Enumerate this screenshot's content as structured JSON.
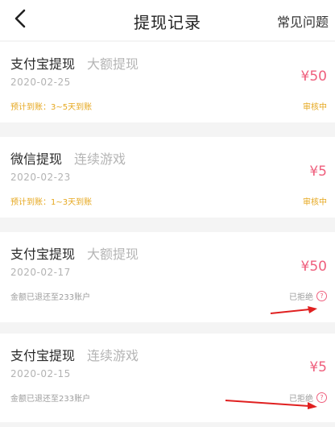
{
  "header": {
    "back_icon": "chevron-left-icon",
    "title": "提现记录",
    "faq_label": "常见问题"
  },
  "records": [
    {
      "name": "支付宝提现",
      "type": "大额提现",
      "date": "2020-02-25",
      "amount": "¥50",
      "note": "预计到账：3~5天到账",
      "status": "审核中"
    },
    {
      "name": "微信提现",
      "type": "连续游戏",
      "date": "2020-02-23",
      "amount": "¥5",
      "note": "预计到账：1~3天到账",
      "status": "审核中"
    },
    {
      "name": "支付宝提现",
      "type": "大额提现",
      "date": "2020-02-17",
      "amount": "¥50",
      "note": "金额已退还至233账户",
      "status": "已拒绝",
      "help_icon": "question-circle-icon",
      "help_glyph": "?"
    },
    {
      "name": "支付宝提现",
      "type": "连续游戏",
      "date": "2020-02-15",
      "amount": "¥5",
      "note": "金额已退还至233账户",
      "status": "已拒绝",
      "help_icon": "question-circle-icon",
      "help_glyph": "?"
    }
  ],
  "colors": {
    "amount": "#ef5f7d",
    "pending": "#e6a820",
    "annotation_arrow": "#e02020"
  }
}
